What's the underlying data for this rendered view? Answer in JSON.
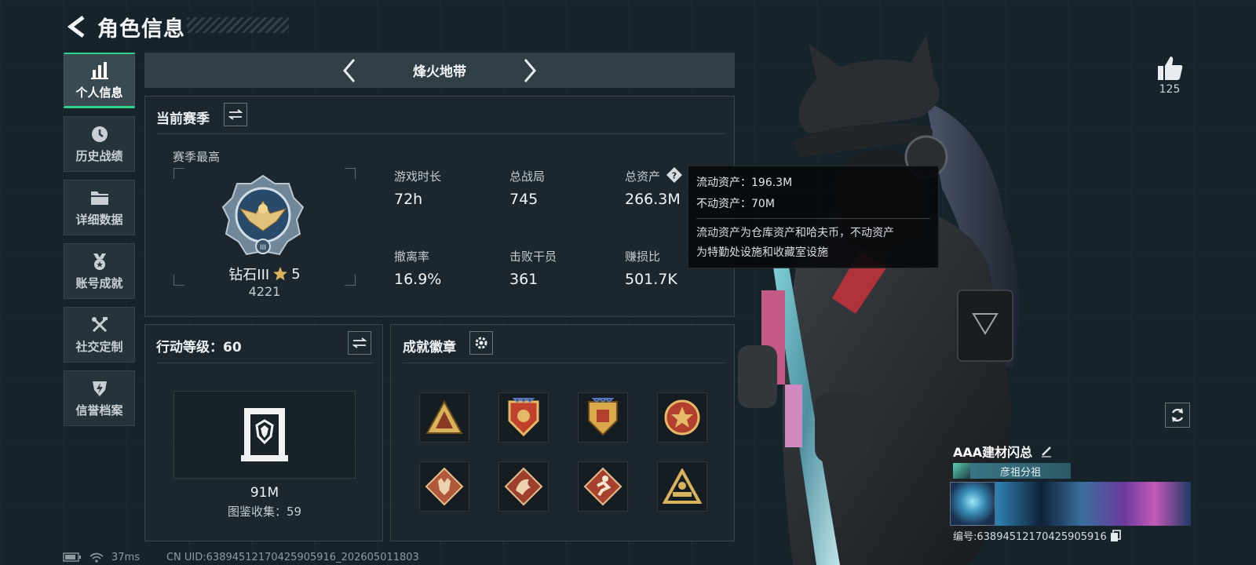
{
  "header": {
    "title": "角色信息"
  },
  "nav": {
    "items": [
      {
        "label": "个人信息",
        "icon": "bar-chart-icon",
        "active": true
      },
      {
        "label": "历史战绩",
        "icon": "clock-icon",
        "active": false
      },
      {
        "label": "详细数据",
        "icon": "folder-icon",
        "active": false
      },
      {
        "label": "账号成就",
        "icon": "medal-icon",
        "active": false
      },
      {
        "label": "社交定制",
        "icon": "tools-icon",
        "active": false
      },
      {
        "label": "信誉档案",
        "icon": "shield-icon",
        "active": false
      }
    ]
  },
  "mode": {
    "title": "烽火地带"
  },
  "season": {
    "title": "当前赛季",
    "best_label": "赛季最高",
    "rank_name": "钻石III",
    "rank_stars": "5",
    "rank_score": "4221",
    "stats": [
      {
        "label": "游戏时长",
        "value": "72h"
      },
      {
        "label": "总战局",
        "value": "745"
      },
      {
        "label": "总资产",
        "value": "266.3M"
      },
      {
        "label": "撤离率",
        "value": "16.9%"
      },
      {
        "label": "击败干员",
        "value": "361"
      },
      {
        "label": "赚损比",
        "value": "501.7K"
      }
    ]
  },
  "tooltip": {
    "liquid": "流动资产：196.3M",
    "fixed": "不动资产：70M",
    "desc_line1": "流动资产为仓库资产和哈夫币，不动资产",
    "desc_line2": "为特勤处设施和收藏室设施"
  },
  "action_level": {
    "title": "行动等级：60",
    "value": "91M",
    "collection": "图鉴收集：59"
  },
  "badges": {
    "title": "成就徽章",
    "items": [
      "badge-1",
      "badge-2",
      "badge-3",
      "badge-4",
      "badge-5",
      "badge-6",
      "badge-7",
      "badge-8"
    ]
  },
  "player": {
    "likes": "125",
    "name": "AAA建材闪总",
    "squad": "彦祖分祖",
    "id": "编号:6389451217042590591​6"
  },
  "status": {
    "ping": "37ms",
    "uid": "CN UID:6389451217042590591​6_202605011803"
  },
  "colors": {
    "accent": "#2fd18c",
    "gold": "#c9a54a",
    "badge_red": "#b3402e"
  }
}
